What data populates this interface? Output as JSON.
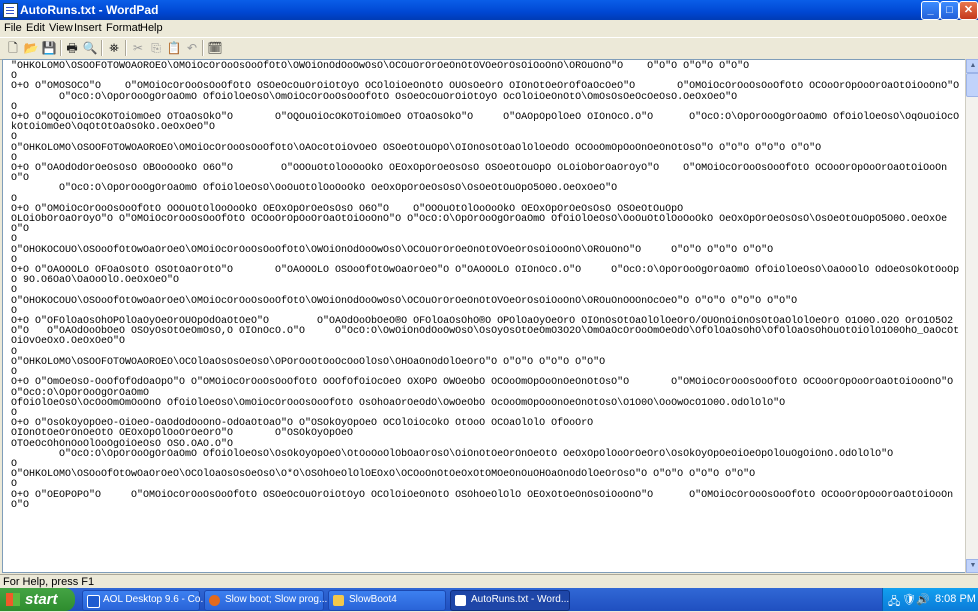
{
  "window": {
    "title": "AutoRuns.txt - WordPad"
  },
  "menu": [
    "File",
    "Edit",
    "View",
    "Insert",
    "Format",
    "Help"
  ],
  "document": {
    "lines": [
      "\"OHKOLOMO\\OSOOFOTOWOAOROEO\\OMOiOcOrOoOsOoOfOtO\\OWOiOnOdOoOwOsO\\OCOuOrOrOeOnOtOVOeOrOsOiOoOnO\\OROuOnO\"O    O\"O\"O O\"O\"O O\"O\"O",
      "O",
      "O+O O\"OMOSOCO\"O    O\"OMOiOcOrOoOsOoOfOtO OSOeOcOuOrOiOtOyO OCOlOiOeOnOtO OUOsOeOrO OIOnOtOeOrOfOaOcOeO\"O       O\"OMOiOcOrOoOsOoOfOtO OCOoOrOpOoOrOaOtOiOoOnO\"O",
      "        O\"OcO:O\\OpOrOoOgOrOaOmO OfOiOlOeOsO\\OmOiOcOrOoOsOoOfOtO OsOeOcOuOrOiOtOyO OcOlOiOeOnOtO\\OmOsOsOeOcOeOsO.OeOxOeO\"O",
      "O",
      "O+O O\"OQOuOiOcOKOTOiOmOeO OTOaOsOkO\"O       O\"OQOuOiOcOKOTOiOmOeO OTOaOsOkO\"O     O\"OAOpOpOlOeO OIOnOcO.O\"O      O\"OcO:O\\OpOrOoOgOrOaOmO OfOiOlOeOsO\\OqOuOiOcOkOtOiOmOeO\\OqOtOtOaOsOkO.OeOxOeO\"O",
      "O",
      "O\"OHKOLOMO\\OSOOFOTOWOAOROEO\\OMOiOcOrOoOsOoOfOtO\\OAOcOtOiOvOeO OSOeOtOuOpO\\OIOnOsOtOaOlOlOeOdO OCOoOmOpOoOnOeOnOtOsO\"O O\"O\"O O\"O\"O O\"O\"O",
      "O",
      "O+O O\"OAOdOdOrOeOsOsO OBOoOoOkO O6O\"O        O\"OOOuOtOlOoOoOkO OEOxOpOrOeOsOsO OSOeOtOuOpO OLOiObOrOaOrOyO\"O    O\"OMOiOcOrOoOsOoOfOtO OCOoOrOpOoOrOaOtOiOoOnO\"O",
      "        O\"OcO:O\\OpOrOoOgOrOaOmO OfOiOlOeOsO\\OoOuOtOlOoOoOkO OeOxOpOrOeOsOsO\\OsOeOtOuOpO5O0O.OeOxOeO\"O",
      "O",
      "O+O O\"OMOiOcOrOoOsOoOfOtO OOOuOtOlOoOoOkO OEOxOpOrOeOsOsO O6O\"O    O\"OOOuOtOlOoOoOkO OEOxOpOrOeOsOsO OSOeOtOuOpO",
      "OLOiObOrOaOrOyO\"O O\"OMOiOcOrOoOsOoOfOtO OCOoOrOpOoOrOaOtOiOoOnO\"O O\"OcO:O\\OpOrOoOgOrOaOmO OfOiOlOeOsO\\OoOuOtOlOoOoOkO OeOxOpOrOeOsOsO\\OsOeOtOuOpO5O0O.OeOxOeO\"O",
      "O",
      "O\"OHOKOCOUO\\OSOoOfOtOwOaOrOeO\\OMOiOcOrOoOsOoOfOtO\\OWOiOnOdOoOwOsO\\OCOuOrOrOeOnOtOVOeOrOsOiOoOnO\\OROuOnO\"O     O\"O\"O O\"O\"O O\"O\"O",
      "O",
      "O+O O\"OAOOOLO OFOaOsOtO OSOtOaOrOtO\"O       O\"OAOOOLO OSOoOfOtOwOaOrOeO\"O O\"OAOOOLO OIOnOcO.O\"O     O\"OcO:O\\OpOrOoOgOrOaOmO OfOiOlOeOsO\\OaOoOlO OdOeOsOkOtOoOpO 9O.O6OaO\\OaOoOlO.OeOxOeO\"O",
      "O",
      "O\"OHOKOCOUO\\OSOoOfOtOwOaOrOeO\\OMOiOcOrOoOsOoOfOtO\\OWOiOnOdOoOwOsO\\OCOuOrOrOeOnOtOVOeOrOsOiOoOnO\\OROuOnOOOnOcOeO\"O O\"O\"O O\"O\"O O\"O\"O",
      "O",
      "O+O O\"OFOlOaOsOhOPOlOaOyOeOrOUOpOdOaOtOeO\"O        O\"OAOdOoObOeO®O OFOlOaOsOhO®O OPOlOaOyOeOrO OIOnOsOtOaOlOlOeOrO/OUOnOiOnOsOtOaOlOlOeOrO O1O0O.O2O OrO1O5O2O\"O   O\"OAOdOoObOeO OSOyOsOtOeOmOsO,O OIOnOcO.O\"O     O\"OcO:O\\OwOiOnOdOoOwOsO\\OsOyOsOtOeOmO3O2O\\OmOaOcOrOoOmOeOdO\\OfOlOaOsOhO\\OfOlOaOsOhOuOtOiOlO1O0OhO_OaOcOtOiOvOeOxO.OeOxOeO\"O",
      "O",
      "O\"OHKOLOMO\\OSOOFOTOWOAOROEO\\OCOlOaOsOsOeOsO\\OPOrOoOtOoOcOoOlOsO\\OHOaOnOdOlOeOrO\"O O\"O\"O O\"O\"O O\"O\"O",
      "O",
      "O+O O\"OmOeOsO-OoOfOfOdOaOpO\"O O\"OMOiOcOrOoOsOoOfOtO OOOfOfOiOcOeO OXOPO OWOeObO OCOoOmOpOoOnOeOnOtOsO\"O       O\"OMOiOcOrOoOsOoOfOtO OCOoOrOpOoOrOaOtOiOoOnO\"O        O\"OcO:O\\OpOrOoOgOrOaOmO",
      "OfOiOlOeOsO\\OcOoOmOmOoOnO OfOiOlOeOsO\\OmOiOcOrOoOsOoOfOtO OsOhOaOrOeOdO\\OwOeObO OcOoOmOpOoOnOeOnOtOsO\\O1O0O\\OoOwOcO1O0O.OdOlOlO\"O",
      "O",
      "O+O O\"OsOkOyOpOeO-OiOeO-OaOdOdOoOnO-OdOaOtOaO\"O O\"OSOkOyOpOeO OCOlOiOcOkO OtOoO OCOaOlOlO OfOoOrO",
      "OIOnOtOeOrOnOeOtO OEOxOpOlOoOrOeOrO\"O       O\"OSOkOyOpOeO",
      "OTOeOcOhOnOoOlOoOgOiOeOsO OSO.OAO.O\"O",
      "        O\"OcO:O\\OpOrOoOgOrOaOmO OfOiOlOeOsO\\OsOkOyOpOeO\\OtOoOoOlObOaOrOsO\\OiOnOtOeOrOnOeOtO OeOxOpOlOoOrOeOrO\\OsOkOyOpOeOiOeOpOlOuOgOiOnO.OdOlOlO\"O",
      "O",
      "O\"OHKOLOMO\\OSOoOfOtOwOaOrOeO\\OCOlOaOsOsOeOsO\\O*O\\OSOhOeOlOlOEOxO\\OCOoOnOtOeOxOtOMOeOnOuOHOaOnOdOlOeOrOsO\"O O\"O\"O O\"O\"O O\"O\"O",
      "O",
      "O+O O\"OEOPOPO\"O     O\"OMOiOcOrOoOsOoOfOtO OSOeOcOuOrOiOtOyO OCOlOiOeOnOtO OSOhOeOlOlO OEOxOtOeOnOsOiOoOnO\"O      O\"OMOiOcOrOoOsOoOfOtO OCOoOrOpOoOrOaOtOiOoOnO\"O"
    ]
  },
  "status": {
    "text": "For Help, press F1"
  },
  "taskbar": {
    "start_label": "start",
    "tasks": [
      "AOL Desktop 9.6 - Co...",
      "Slow boot; Slow prog...",
      "SlowBoot4",
      "AutoRuns.txt - Word..."
    ],
    "clock": "8:08 PM"
  },
  "icons": [
    "new-icon",
    "open-icon",
    "save-icon",
    "print-icon",
    "print-preview-icon",
    "find-icon",
    "cut-icon",
    "copy-icon",
    "paste-icon",
    "undo-icon",
    "insert-datetime-icon"
  ],
  "colors": {
    "titlebar": "#0047d3",
    "taskbar": "#245edb",
    "start": "#3c9a3c",
    "chrome": "#ece9d8"
  }
}
